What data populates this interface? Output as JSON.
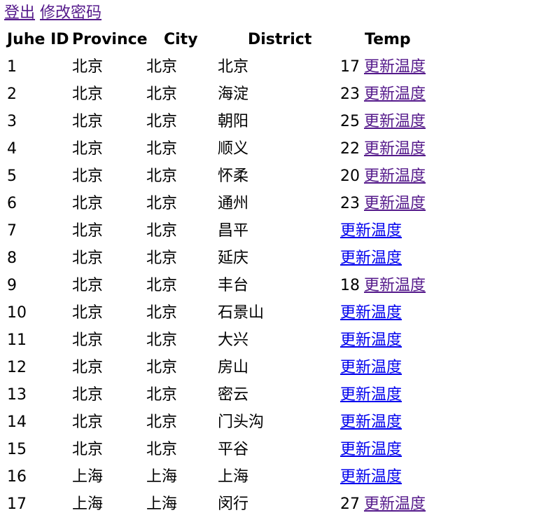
{
  "top_links": {
    "logout": "登出",
    "change_password": "修改密码"
  },
  "table": {
    "headers": [
      "Juhe ID",
      "Province",
      "City",
      "District",
      "Temp"
    ],
    "rows": [
      {
        "id": "1",
        "province": "北京",
        "city": "北京",
        "district": "北京",
        "temp": "17",
        "link": "更新温度",
        "visited": true
      },
      {
        "id": "2",
        "province": "北京",
        "city": "北京",
        "district": "海淀",
        "temp": "23",
        "link": "更新温度",
        "visited": true
      },
      {
        "id": "3",
        "province": "北京",
        "city": "北京",
        "district": "朝阳",
        "temp": "25",
        "link": "更新温度",
        "visited": true
      },
      {
        "id": "4",
        "province": "北京",
        "city": "北京",
        "district": "顺义",
        "temp": "22",
        "link": "更新温度",
        "visited": true
      },
      {
        "id": "5",
        "province": "北京",
        "city": "北京",
        "district": "怀柔",
        "temp": "20",
        "link": "更新温度",
        "visited": true
      },
      {
        "id": "6",
        "province": "北京",
        "city": "北京",
        "district": "通州",
        "temp": "23",
        "link": "更新温度",
        "visited": true
      },
      {
        "id": "7",
        "province": "北京",
        "city": "北京",
        "district": "昌平",
        "temp": "",
        "link": "更新温度",
        "visited": false
      },
      {
        "id": "8",
        "province": "北京",
        "city": "北京",
        "district": "延庆",
        "temp": "",
        "link": "更新温度",
        "visited": false
      },
      {
        "id": "9",
        "province": "北京",
        "city": "北京",
        "district": "丰台",
        "temp": "18",
        "link": "更新温度",
        "visited": true
      },
      {
        "id": "10",
        "province": "北京",
        "city": "北京",
        "district": "石景山",
        "temp": "",
        "link": "更新温度",
        "visited": false
      },
      {
        "id": "11",
        "province": "北京",
        "city": "北京",
        "district": "大兴",
        "temp": "",
        "link": "更新温度",
        "visited": false
      },
      {
        "id": "12",
        "province": "北京",
        "city": "北京",
        "district": "房山",
        "temp": "",
        "link": "更新温度",
        "visited": false
      },
      {
        "id": "13",
        "province": "北京",
        "city": "北京",
        "district": "密云",
        "temp": "",
        "link": "更新温度",
        "visited": false
      },
      {
        "id": "14",
        "province": "北京",
        "city": "北京",
        "district": "门头沟",
        "temp": "",
        "link": "更新温度",
        "visited": false
      },
      {
        "id": "15",
        "province": "北京",
        "city": "北京",
        "district": "平谷",
        "temp": "",
        "link": "更新温度",
        "visited": false
      },
      {
        "id": "16",
        "province": "上海",
        "city": "上海",
        "district": "上海",
        "temp": "",
        "link": "更新温度",
        "visited": false
      },
      {
        "id": "17",
        "province": "上海",
        "city": "上海",
        "district": "闵行",
        "temp": "27",
        "link": "更新温度",
        "visited": true
      }
    ]
  },
  "colors": {
    "link_visited": "#551a8b",
    "link_unvisited": "#0000ee",
    "text": "#000000",
    "background": "#ffffff"
  }
}
